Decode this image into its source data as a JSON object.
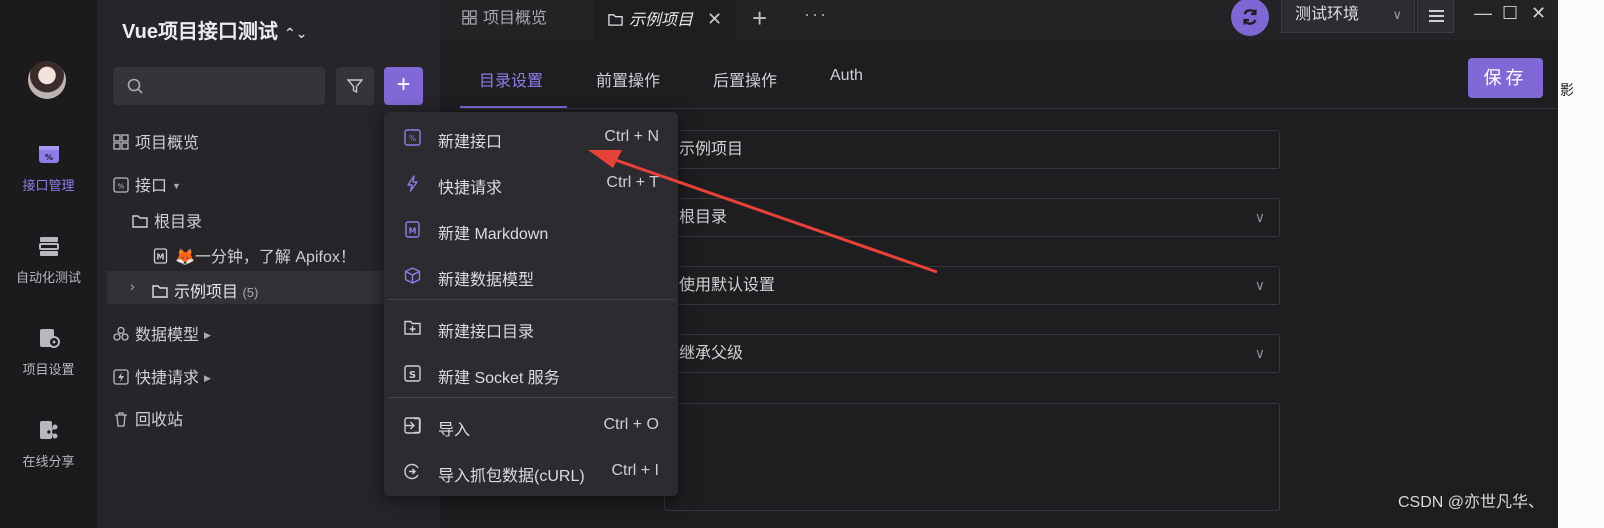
{
  "project": {
    "name": "Vue项目接口测试",
    "switch_icon": "updown-chevron-icon"
  },
  "user": {
    "avatar_icon": "user-avatar"
  },
  "rail": [
    {
      "label": "接口管理",
      "icon": "api-icon",
      "active": true
    },
    {
      "label": "自动化测试",
      "icon": "automation-icon",
      "active": false
    },
    {
      "label": "项目设置",
      "icon": "project-settings-icon",
      "active": false
    },
    {
      "label": "在线分享",
      "icon": "share-icon",
      "active": false
    }
  ],
  "search": {
    "placeholder": ""
  },
  "tree": {
    "overview": "项目概览",
    "apis": "接口",
    "root": "根目录",
    "doc": "🦊一分钟，了解 Apifox！",
    "example": "示例项目",
    "example_count": "(5)",
    "models": "数据模型",
    "quick": "快捷请求",
    "trash": "回收站"
  },
  "tabs": [
    {
      "label": "项目概览",
      "active": false
    },
    {
      "label": "示例项目",
      "active": true
    }
  ],
  "tab_close": "✕",
  "tab_plus": "+",
  "tab_more": "···",
  "environment": {
    "selected": "测试环境",
    "arrow": "∨"
  },
  "window_controls": {
    "minimize": "—",
    "maximize": "☐",
    "close": "✕"
  },
  "subtabs": [
    {
      "label": "目录设置",
      "active": true
    },
    {
      "label": "前置操作",
      "active": false
    },
    {
      "label": "后置操作",
      "active": false
    },
    {
      "label": "Auth",
      "active": false
    }
  ],
  "save_label": "保存",
  "form": {
    "name_value": "示例项目",
    "parent_value": "根目录",
    "setting_value": "使用默认设置",
    "inherit_value": "继承父级",
    "select_arrow": "∨"
  },
  "dropdown": {
    "items": [
      {
        "label": "新建接口",
        "shortcut": "Ctrl + N",
        "icon": "new-api-icon"
      },
      {
        "label": "快捷请求",
        "shortcut": "Ctrl + T",
        "icon": "lightning-icon"
      },
      {
        "label": "新建 Markdown",
        "shortcut": "",
        "icon": "markdown-icon"
      },
      {
        "label": "新建数据模型",
        "shortcut": "",
        "icon": "cube-icon"
      },
      {
        "label": "新建接口目录",
        "shortcut": "",
        "icon": "folder-plus-icon"
      },
      {
        "label": "新建 Socket 服务",
        "shortcut": "",
        "icon": "socket-icon"
      },
      {
        "label": "导入",
        "shortcut": "Ctrl + O",
        "icon": "import-icon"
      },
      {
        "label": "导入抓包数据(cURL)",
        "shortcut": "Ctrl + I",
        "icon": "capture-import-icon"
      }
    ]
  },
  "annotation": {
    "arrow_color": "#e8413a"
  },
  "right_strip_text": "影",
  "watermark": "CSDN @亦世凡华、",
  "colors": {
    "accent": "#8069d6",
    "background": "#1e1e21",
    "panel": "#26262a"
  }
}
